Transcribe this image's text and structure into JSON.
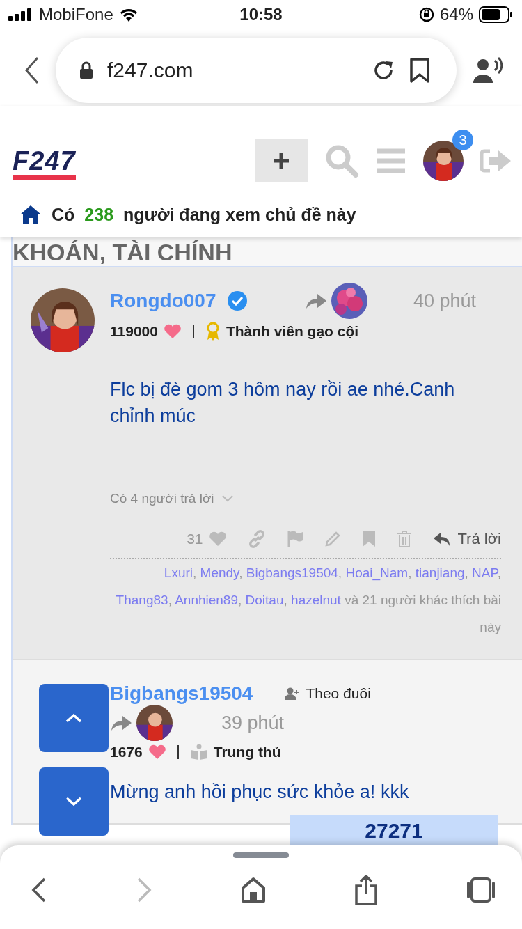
{
  "status_bar": {
    "carrier": "MobiFone",
    "time": "10:58",
    "battery": "64%"
  },
  "browser": {
    "url": "f247.com"
  },
  "site_header": {
    "logo": "F247",
    "notification_count": "3"
  },
  "viewers": {
    "prefix": "Có",
    "count": "238",
    "suffix": "người đang xem chủ đề này"
  },
  "topic_title": "KHOÁN, TÀI CHÍNH",
  "posts": [
    {
      "username": "Rongdo007",
      "verified": true,
      "highlighted": true,
      "time": "40 phút",
      "likes": "119000",
      "rank": {
        "kind": "award",
        "label": "Thành viên gạo cội"
      },
      "body": "Flc bị đè gom 3 hôm nay rồi ae nhé.Canh chỉnh múc",
      "replies": "Có 4 người trả lời",
      "like_count": "31",
      "reply_label": "Trả lời",
      "likers": {
        "names": [
          "Lxuri",
          "Mendy",
          "Bigbangs19504",
          "Hoai_Nam",
          "tianjiang",
          "NAP",
          "Thang83",
          "Annhien89",
          "Doitau",
          "hazelnut"
        ],
        "separator": ",",
        "suffix": "và 21 người khác thích bài này"
      }
    },
    {
      "username": "Bigbangs19504",
      "verified": false,
      "highlighted": false,
      "follow": "Theo đuôi",
      "time": "39 phút",
      "likes": "1676",
      "rank": {
        "kind": "book",
        "label": "Trung thủ"
      },
      "body": "Mừng anh hồi phục sức khỏe a! kkk"
    }
  ],
  "counter_box": "27271"
}
